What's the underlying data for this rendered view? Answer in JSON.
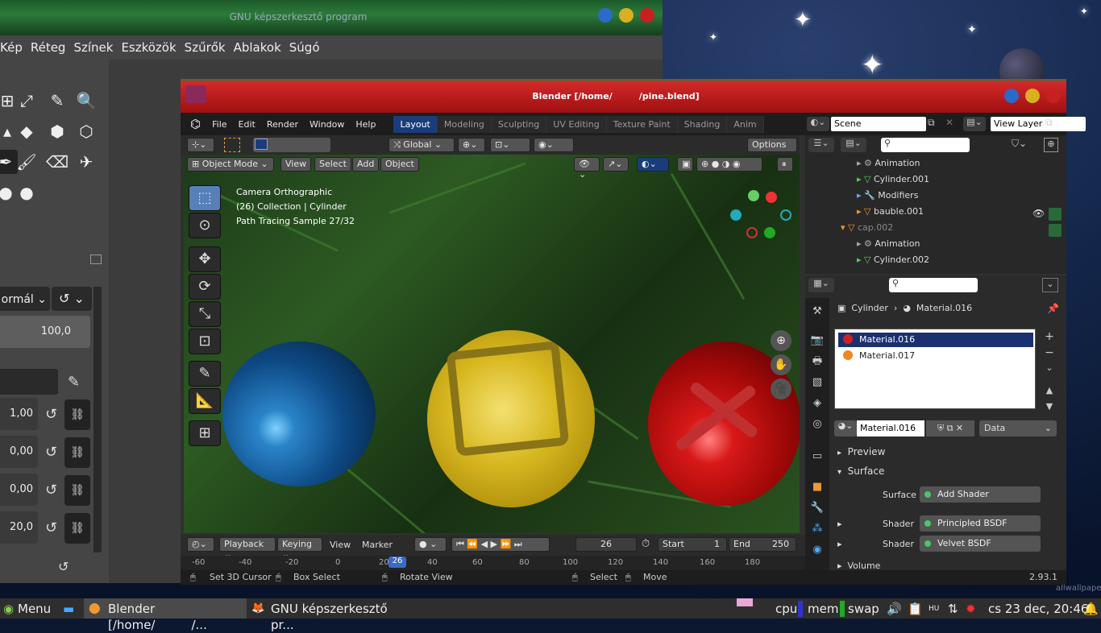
{
  "gimp": {
    "title": "GNU képszerkesztő program",
    "menu": [
      "Kép",
      "Réteg",
      "Színek",
      "Eszközök",
      "Szűrők",
      "Ablakok",
      "Súgó"
    ],
    "mode_value": "ormál",
    "opacity_value": "100,0",
    "spin_values": [
      "1,00",
      "0,00",
      "0,00",
      "20,0"
    ]
  },
  "blender": {
    "title": "Blender [/home/   /pine.blend]",
    "menu": [
      "File",
      "Edit",
      "Render",
      "Window",
      "Help"
    ],
    "workspaces": [
      "Layout",
      "Modeling",
      "Sculpting",
      "UV Editing",
      "Texture Paint",
      "Shading",
      "Anim"
    ],
    "active_workspace": "Layout",
    "scene_label": "Scene",
    "view_layer_label": "View Layer",
    "transform_orientation": "Global",
    "options_label": "Options",
    "mode": "Object Mode",
    "viewport_menu": [
      "View",
      "Select",
      "Add",
      "Object"
    ],
    "overlay_text": [
      "Camera Orthographic",
      "(26) Collection | Cylinder",
      "Path Tracing Sample 27/32"
    ],
    "timeline": {
      "playback": "Playback",
      "keying": "Keying",
      "view": "View",
      "marker": "Marker",
      "frame": "26",
      "start_label": "Start",
      "start": "1",
      "end_label": "End",
      "end": "250",
      "ruler": [
        "-60",
        "-40",
        "-20",
        "0",
        "20",
        "26",
        "40",
        "60",
        "80",
        "100",
        "120",
        "140",
        "160",
        "180"
      ]
    },
    "status": {
      "set_cursor": "Set 3D Cursor",
      "box_select": "Box Select",
      "rotate_view": "Rotate View",
      "select": "Select",
      "move": "Move",
      "version": "2.93.1"
    },
    "outliner": [
      {
        "label": "Animation",
        "indent": 3,
        "color": "#ddd"
      },
      {
        "label": "Cylinder.001",
        "indent": 3,
        "color": "#ddd"
      },
      {
        "label": "Modifiers",
        "indent": 3,
        "color": "#ddd"
      },
      {
        "label": "bauble.001",
        "indent": 3,
        "color": "#ddd"
      },
      {
        "label": "cap.002",
        "indent": 2,
        "color": "#888"
      },
      {
        "label": "Animation",
        "indent": 3,
        "color": "#ddd"
      },
      {
        "label": "Cylinder.002",
        "indent": 3,
        "color": "#ddd"
      }
    ],
    "properties": {
      "breadcrumb_object": "Cylinder",
      "breadcrumb_material": "Material.016",
      "slots": [
        "Material.016",
        "Material.017"
      ],
      "selected_slot": "Material.016",
      "material_name": "Material.016",
      "link": "Data",
      "preview_label": "Preview",
      "surface_section": "Surface",
      "surface_label": "Surface",
      "surface_value": "Add Shader",
      "shader_label": "Shader",
      "shader1": "Principled BSDF",
      "shader2": "Velvet BSDF",
      "volume_label": "Volume"
    }
  },
  "taskbar": {
    "menu": "Menu",
    "task1": "Blender [/home/   /...",
    "task2": "GNU képszerkesztő pr...",
    "cpu": "cpu",
    "mem": "mem",
    "swap": "swap",
    "clock": "cs 23 dec, 20:46"
  },
  "watermark": "allwallpapersfree.org"
}
